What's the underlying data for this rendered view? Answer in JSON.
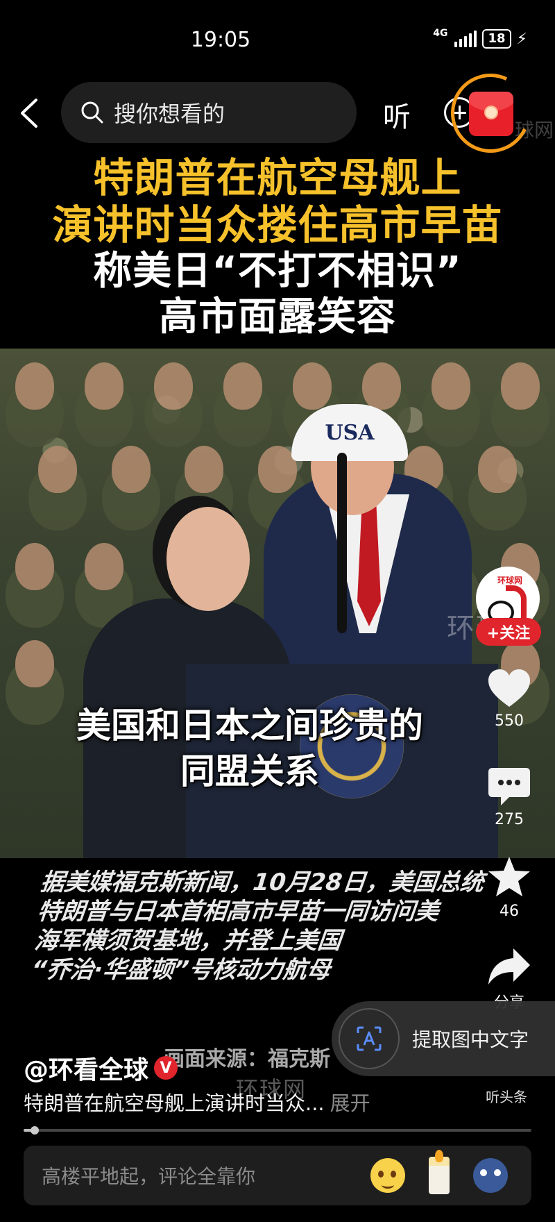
{
  "status_bar": {
    "time": "19:05",
    "network": "4G",
    "battery": "18"
  },
  "top_nav": {
    "search_placeholder": "搜你想看的",
    "listen_label": "听",
    "watermark": "球网"
  },
  "headline": {
    "line1": "特朗普在航空母舰上",
    "line2": "演讲时当众搂住高市早苗",
    "line3": "称美日“不打不相识”",
    "line4": "高市面露笑容"
  },
  "video": {
    "cap_text": "USA",
    "watermark": "环球网",
    "caption_line1": "美国和日本之间珍贵的",
    "caption_line2": "同盟关系"
  },
  "description": {
    "line1": "据美媒福克斯新闻，10月28日，美国总统",
    "line2": "特朗普与日本首相高市早苗一同访问美",
    "line3": "海军横须贺基地，并登上美国",
    "line4": "“乔治·华盛顿”号核动力航母",
    "source": "画面来源：福克斯",
    "source_watermark": "环球网"
  },
  "side_actions": {
    "avatar_logo": "环球网",
    "follow_label": "+关注",
    "likes": "550",
    "comments": "275",
    "favorites": "46",
    "share_label": "分享",
    "toutiao_label": "听头条"
  },
  "extract_text": {
    "label": "提取图中文字"
  },
  "footer": {
    "author": "@环看全球",
    "verified_mark": "V",
    "title": "特朗普在航空母舰上演讲时当众...",
    "expand_label": "展开",
    "progress": 0.02,
    "comment_placeholder": "高楼平地起，评论全靠你"
  },
  "colors": {
    "headline_yellow": "#f6c12b",
    "accent_red": "#e0252d",
    "background": "#000000"
  }
}
